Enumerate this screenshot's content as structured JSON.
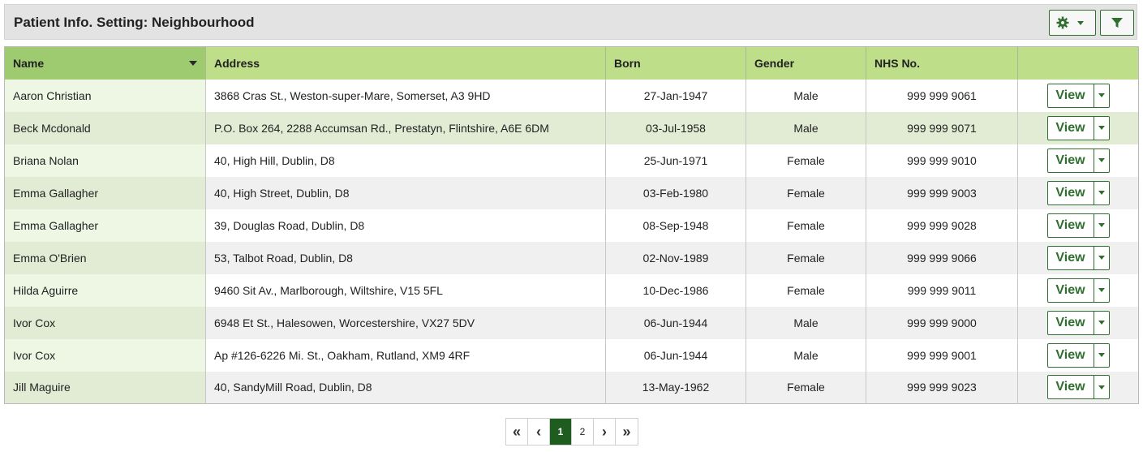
{
  "header": {
    "title": "Patient Info. Setting: Neighbourhood",
    "settings_icon": "gear-icon",
    "filter_icon": "filter-icon"
  },
  "columns": [
    "Name",
    "Address",
    "Born",
    "Gender",
    "NHS No.",
    ""
  ],
  "rows": [
    {
      "name": "Aaron Christian",
      "address": "3868 Cras St., Weston-super-Mare, Somerset, A3 9HD",
      "born": "27-Jan-1947",
      "gender": "Male",
      "nhs": "999 999 9061",
      "action": "View"
    },
    {
      "name": "Beck Mcdonald",
      "address": "P.O. Box 264, 2288 Accumsan Rd., Prestatyn, Flintshire, A6E 6DM",
      "born": "03-Jul-1958",
      "gender": "Male",
      "nhs": "999 999 9071",
      "action": "View"
    },
    {
      "name": "Briana Nolan",
      "address": "40, High Hill, Dublin, D8",
      "born": "25-Jun-1971",
      "gender": "Female",
      "nhs": "999 999 9010",
      "action": "View"
    },
    {
      "name": "Emma Gallagher",
      "address": "40, High Street, Dublin, D8",
      "born": "03-Feb-1980",
      "gender": "Female",
      "nhs": "999 999 9003",
      "action": "View"
    },
    {
      "name": "Emma Gallagher",
      "address": "39, Douglas Road, Dublin, D8",
      "born": "08-Sep-1948",
      "gender": "Female",
      "nhs": "999 999 9028",
      "action": "View"
    },
    {
      "name": "Emma O'Brien",
      "address": "53, Talbot Road, Dublin, D8",
      "born": "02-Nov-1989",
      "gender": "Female",
      "nhs": "999 999 9066",
      "action": "View"
    },
    {
      "name": "Hilda Aguirre",
      "address": "9460 Sit Av., Marlborough, Wiltshire, V15 5FL",
      "born": "10-Dec-1986",
      "gender": "Female",
      "nhs": "999 999 9011",
      "action": "View"
    },
    {
      "name": "Ivor Cox",
      "address": "6948 Et St., Halesowen, Worcestershire, VX27 5DV",
      "born": "06-Jun-1944",
      "gender": "Male",
      "nhs": "999 999 9000",
      "action": "View"
    },
    {
      "name": "Ivor Cox",
      "address": "Ap #126-6226 Mi. St., Oakham, Rutland, XM9 4RF",
      "born": "06-Jun-1944",
      "gender": "Male",
      "nhs": "999 999 9001",
      "action": "View"
    },
    {
      "name": "Jill Maguire",
      "address": "40, SandyMill Road, Dublin, D8",
      "born": "13-May-1962",
      "gender": "Female",
      "nhs": "999 999 9023",
      "action": "View"
    }
  ],
  "pagination": {
    "first": "«",
    "prev": "‹",
    "pages": [
      "1",
      "2"
    ],
    "current": "1",
    "next": "›",
    "last": "»"
  },
  "colors": {
    "header_green": "#bede8a",
    "sorted_header_green": "#9fcb70",
    "accent_dark_green": "#2f6f2f",
    "active_page": "#1f5c1f"
  }
}
